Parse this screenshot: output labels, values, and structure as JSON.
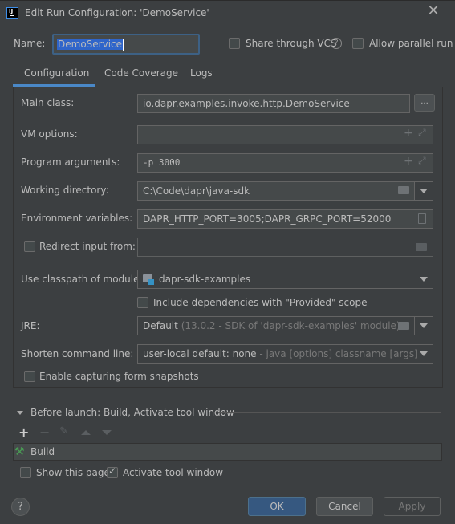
{
  "window": {
    "title": "Edit Run Configuration: 'DemoService'",
    "app_icon": "intellij-icon",
    "close_icon": "close-icon"
  },
  "header": {
    "name_label": "Name:",
    "name_value": "DemoService",
    "share_vcs_label": "Share through VCS",
    "share_vcs_checked": false,
    "allow_parallel_label": "Allow parallel run",
    "allow_parallel_checked": false
  },
  "tabs": [
    {
      "label": "Configuration",
      "active": true
    },
    {
      "label": "Code Coverage",
      "active": false
    },
    {
      "label": "Logs",
      "active": false
    }
  ],
  "form": {
    "main_class": {
      "label": "Main class:",
      "value": "io.dapr.examples.invoke.http.DemoService",
      "button": "..."
    },
    "vm_options": {
      "label": "VM options:",
      "value": ""
    },
    "program_arguments": {
      "label": "Program arguments:",
      "value": "-p 3000"
    },
    "working_directory": {
      "label": "Working directory:",
      "value": "C:\\Code\\dapr\\java-sdk"
    },
    "environment_variables": {
      "label": "Environment variables:",
      "value": "DAPR_HTTP_PORT=3005;DAPR_GRPC_PORT=52000"
    },
    "redirect_input": {
      "label": "Redirect input from:",
      "value": "",
      "checked": false
    },
    "classpath_module": {
      "label": "Use classpath of module:",
      "value": "dapr-sdk-examples"
    },
    "include_provided": {
      "label": "Include dependencies with \"Provided\" scope",
      "checked": false
    },
    "jre": {
      "label": "JRE:",
      "value_main": "Default",
      "value_hint": "(13.0.2 - SDK of 'dapr-sdk-examples' module)"
    },
    "shorten_command_line": {
      "label": "Shorten command line:",
      "value_main": "user-local default: none",
      "value_hint": " - java [options] classname [args]"
    },
    "capture_snapshots": {
      "label": "Enable capturing form snapshots",
      "checked": false
    }
  },
  "before_launch": {
    "title": "Before launch: Build, Activate tool window",
    "toolbar": [
      "add",
      "remove",
      "edit",
      "move-up",
      "move-down"
    ],
    "tasks": [
      {
        "label": "Build",
        "icon": "build-hammer-icon"
      }
    ],
    "show_this_page": {
      "label": "Show this page",
      "checked": false
    },
    "activate_tool_window": {
      "label": "Activate tool window",
      "checked": true
    }
  },
  "footer": {
    "help": "?",
    "ok": "OK",
    "cancel": "Cancel",
    "apply": "Apply"
  },
  "colors": {
    "background": "#3c3f41",
    "accent": "#4a88c7",
    "ok_button": "#365880",
    "build_icon": "#499c54",
    "module_icon": "#3592c4"
  }
}
